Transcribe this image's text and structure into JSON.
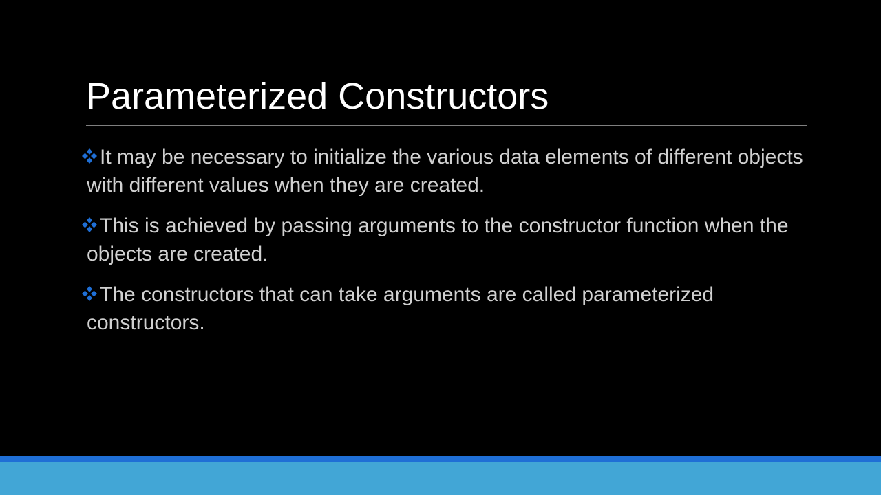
{
  "slide": {
    "title": "Parameterized Constructors",
    "bullet_icon": "four-diamond-bullet-icon",
    "accent_color": "#1f6fd6",
    "band_color": "#42a6d6",
    "bullets": [
      {
        "text": "It may be necessary to initialize the various data elements of different objects with different values when they are created."
      },
      {
        "text": "This is achieved  by passing arguments to the constructor function when the objects are created."
      },
      {
        "text": "The constructors that can take arguments are called parameterized constructors."
      }
    ]
  }
}
